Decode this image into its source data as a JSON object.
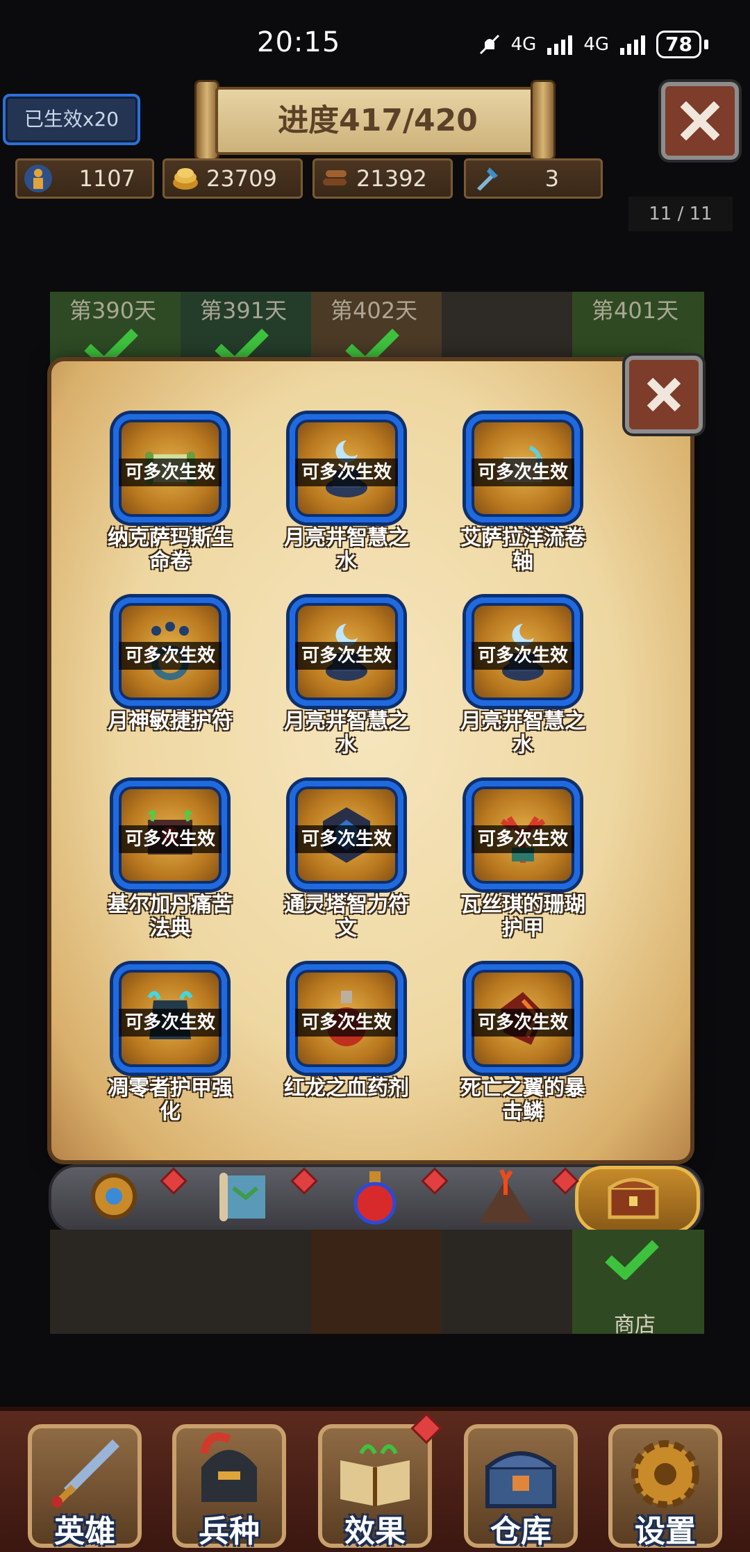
{
  "status": {
    "time": "20:15",
    "signal1": "4G",
    "signal2": "4G",
    "battery": "78"
  },
  "hud": {
    "active_badge": "已生效x20",
    "progress": "进度417/420",
    "resources": [
      {
        "name": "population-icon",
        "value": "1107",
        "color": "#d9a23a"
      },
      {
        "name": "gold-icon",
        "value": "23709",
        "color": "#d8a63a"
      },
      {
        "name": "wood-icon",
        "value": "21392",
        "color": "#8a4f25"
      },
      {
        "name": "crystal-icon",
        "value": "3",
        "color": "#4aa3d8"
      }
    ],
    "page_counter": "11 / 11"
  },
  "days": [
    "第390天",
    "第391天",
    "第402天",
    "",
    "第401天"
  ],
  "items": [
    {
      "tag": "可多次生效",
      "name": "纳克萨玛斯生命卷",
      "icon": "scroll-icon"
    },
    {
      "tag": "可多次生效",
      "name": "月亮井智慧之水",
      "icon": "moon-well-icon"
    },
    {
      "tag": "可多次生效",
      "name": "艾萨拉洋流卷轴",
      "icon": "scroll-icon"
    },
    {
      "tag": "可多次生效",
      "name": "月神敏捷护符",
      "icon": "amulet-icon"
    },
    {
      "tag": "可多次生效",
      "name": "月亮井智慧之水",
      "icon": "moon-well-icon"
    },
    {
      "tag": "可多次生效",
      "name": "月亮井智慧之水",
      "icon": "moon-well-icon"
    },
    {
      "tag": "可多次生效",
      "name": "基尔加丹痛苦法典",
      "icon": "tome-icon"
    },
    {
      "tag": "可多次生效",
      "name": "通灵塔智力符文",
      "icon": "rune-icon"
    },
    {
      "tag": "可多次生效",
      "name": "瓦丝琪的珊瑚护甲",
      "icon": "coral-armor-icon"
    },
    {
      "tag": "可多次生效",
      "name": "凋零者护甲强化",
      "icon": "armor-icon"
    },
    {
      "tag": "可多次生效",
      "name": "红龙之血药剂",
      "icon": "potion-icon"
    },
    {
      "tag": "可多次生效",
      "name": "死亡之翼的暴击鳞",
      "icon": "scale-icon"
    }
  ],
  "tabs": [
    {
      "name": "gear-tab-icon"
    },
    {
      "name": "map-tab-icon"
    },
    {
      "name": "potion-tab-icon"
    },
    {
      "name": "volcano-tab-icon"
    },
    {
      "name": "chest-tab-icon"
    }
  ],
  "shop_label": "商店",
  "nav": [
    {
      "label": "英雄",
      "icon": "sword-icon"
    },
    {
      "label": "兵种",
      "icon": "helmet-icon"
    },
    {
      "label": "效果",
      "icon": "book-icon"
    },
    {
      "label": "仓库",
      "icon": "chest-icon"
    },
    {
      "label": "设置",
      "icon": "gear-icon"
    }
  ]
}
